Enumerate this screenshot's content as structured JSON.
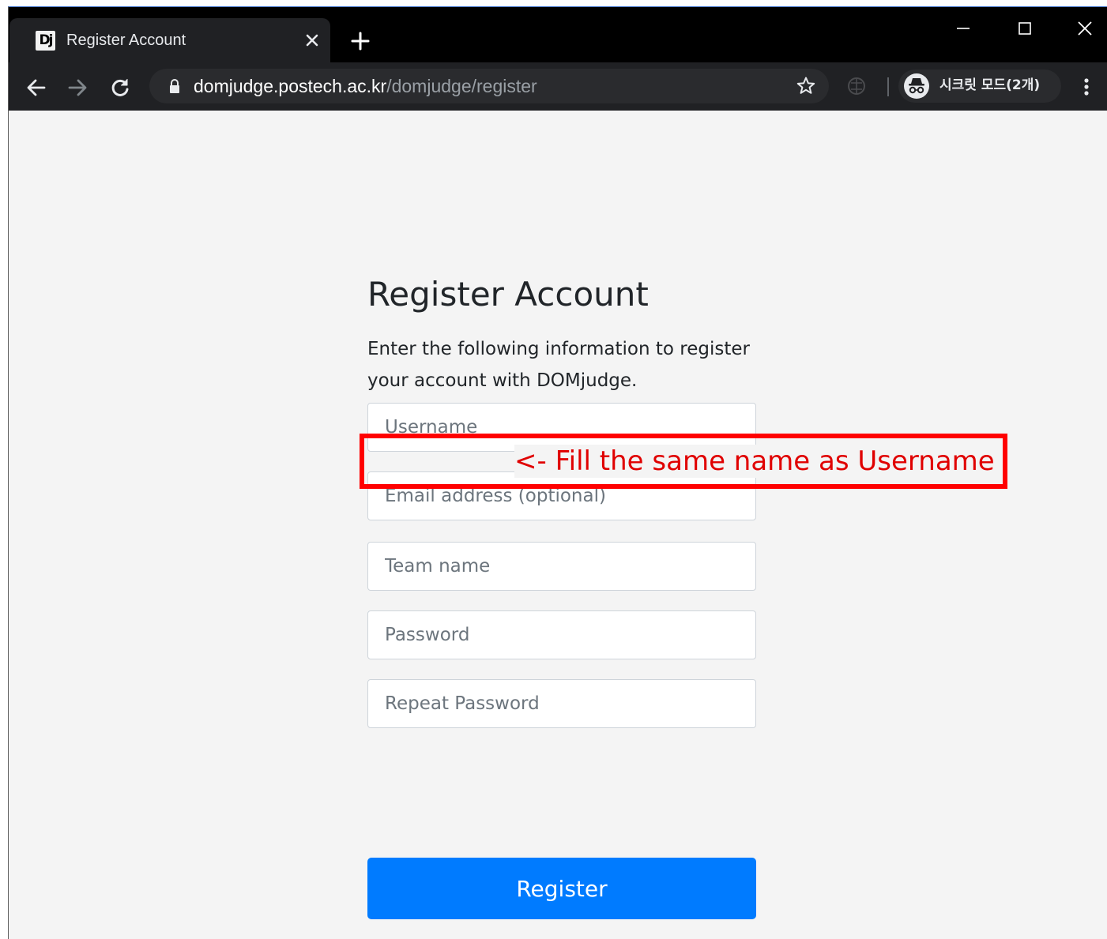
{
  "browser": {
    "tab_title": "Register Account",
    "favicon_text": "Dj",
    "url_host": "domjudge.postech.ac.kr",
    "url_path": "/domjudge/register",
    "incognito_label": "시크릿 모드(2개)"
  },
  "page": {
    "heading": "Register Account",
    "intro": "Enter the following information to register your account with DOMjudge.",
    "fields": {
      "username": "Username",
      "email": "Email address (optional)",
      "team_name": "Team name",
      "password": "Password",
      "repeat_password": "Repeat Password"
    },
    "register_label": "Register"
  },
  "annotation": {
    "text": "<- Fill the same name as Username",
    "color": "#ff0000"
  },
  "icons": [
    "close-icon",
    "plus-icon",
    "minimize-icon",
    "maximize-icon",
    "window-close-icon",
    "back-icon",
    "forward-icon",
    "reload-icon",
    "lock-icon",
    "star-icon",
    "extension-icon",
    "incognito-icon",
    "menu-icon"
  ],
  "colors": {
    "primary_button": "#007bff",
    "page_background": "#f4f4f4",
    "browser_frame": "#202124"
  }
}
